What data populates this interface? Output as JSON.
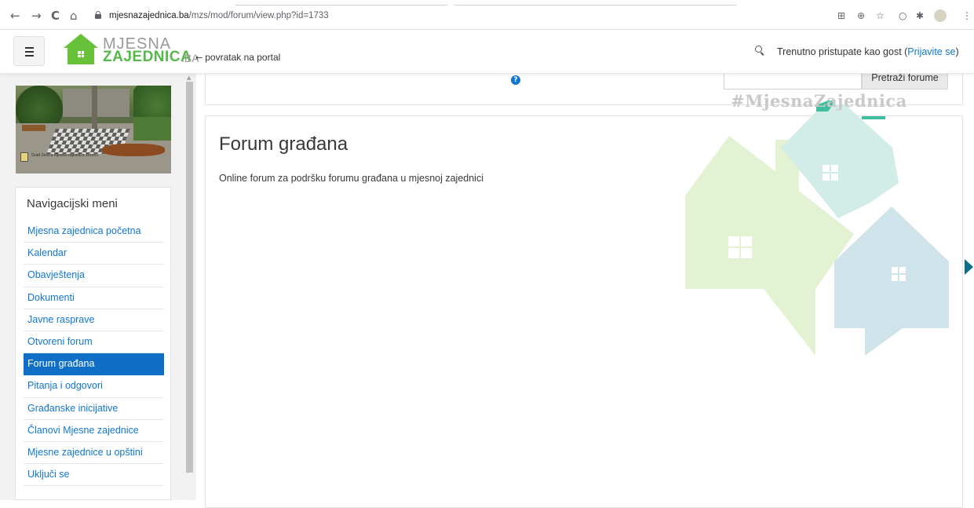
{
  "browser": {
    "back_icon": "←",
    "forward_icon": "→",
    "reload_icon": "C",
    "home_icon": "⌂",
    "url_host": "mjesnazajednica.ba",
    "url_path": "/mzs/mod/forum/view.php?id=1733",
    "ext_icons": [
      "translate-icon",
      "zoom-icon",
      "star-icon",
      "record-icon",
      "puzzle-icon",
      "profile-icon",
      "menu-icon"
    ]
  },
  "header": {
    "logo_line1": "MJESNA",
    "logo_line2": "ZAJEDNICA",
    "logo_suffix": ".BA",
    "back_arrow": "←",
    "back_label": "povratak na portal",
    "login_text": "Trenutno pristupate kao gost (",
    "login_link": "Prijavite se",
    "login_close": ")"
  },
  "sidebar": {
    "photo_caption": "Grad Zenica Mjesna zajednica Jezerci",
    "nav_title": "Navigacijski meni",
    "items": [
      {
        "label": "Mjesna zajednica početna",
        "active": false
      },
      {
        "label": "Kalendar",
        "active": false
      },
      {
        "label": "Obavještenja",
        "active": false
      },
      {
        "label": "Dokumenti",
        "active": false
      },
      {
        "label": "Javne rasprave",
        "active": false
      },
      {
        "label": "Otvoreni forum",
        "active": false
      },
      {
        "label": "Forum građana",
        "active": true
      },
      {
        "label": "Pitanja i odgovori",
        "active": false
      },
      {
        "label": "Građanske inicijative",
        "active": false
      },
      {
        "label": "Članovi Mjesne zajednice",
        "active": false
      },
      {
        "label": "Mjesne zajednice u opštini",
        "active": false
      },
      {
        "label": "Uključi se",
        "active": false
      }
    ]
  },
  "search": {
    "help_icon": "?",
    "input_value": "",
    "button_label": "Pretraži forume"
  },
  "main": {
    "hashtag": "#MjesnaZajednica",
    "forum_title": "Forum građana",
    "forum_description": "Online forum za podršku forumu građana u mjesnoj zajednici"
  },
  "colors": {
    "accent": "#1177d1",
    "active_nav": "#0f6fc6",
    "logo_green": "#56b84a",
    "house_green": "#e3f2d2",
    "house_teal": "#d2ece8",
    "house_blue": "#cfe3ea"
  }
}
